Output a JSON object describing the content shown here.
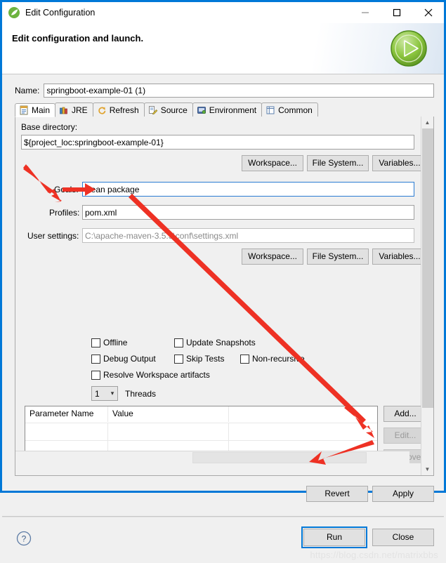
{
  "window": {
    "title": "Edit Configuration",
    "icon": "springboot-leaf-icon",
    "minimize_label": "—",
    "maximize_label": "☐",
    "close_label": "✕"
  },
  "banner": {
    "title": "Edit configuration and launch.",
    "icon": "run-play-icon"
  },
  "name_field": {
    "label": "Name:",
    "value": "springboot-example-01 (1)"
  },
  "tabs": [
    {
      "label": "Main",
      "icon": "main-form-icon",
      "active": true
    },
    {
      "label": "JRE",
      "icon": "jre-library-icon",
      "active": false
    },
    {
      "label": "Refresh",
      "icon": "refresh-icon",
      "active": false
    },
    {
      "label": "Source",
      "icon": "source-edit-icon",
      "active": false
    },
    {
      "label": "Environment",
      "icon": "environment-icon",
      "active": false
    },
    {
      "label": "Common",
      "icon": "common-icon",
      "active": false
    }
  ],
  "main_tab": {
    "base_directory": {
      "label": "Base directory:",
      "value": "${project_loc:springboot-example-01}"
    },
    "dir_buttons": [
      {
        "label": "Workspace..."
      },
      {
        "label": "File System..."
      },
      {
        "label": "Variables..."
      }
    ],
    "goals": {
      "label": "Goals:",
      "value": "clean package",
      "focused": true
    },
    "profiles": {
      "label": "Profiles:",
      "value": "pom.xml"
    },
    "user_settings": {
      "label": "User settings:",
      "value": "C:\\apache-maven-3.5.3\\conf\\settings.xml",
      "disabled": true
    },
    "settings_buttons": [
      {
        "label": "Workspace..."
      },
      {
        "label": "File System..."
      },
      {
        "label": "Variables..."
      }
    ],
    "checkboxes": [
      {
        "label": "Offline",
        "checked": false
      },
      {
        "label": "Update Snapshots",
        "checked": false
      },
      {
        "label": "Debug Output",
        "checked": false
      },
      {
        "label": "Skip Tests",
        "checked": false
      },
      {
        "label": "Non-recursive",
        "checked": false
      },
      {
        "label": "Resolve Workspace artifacts",
        "checked": false
      }
    ],
    "threads": {
      "value": "1",
      "label": "Threads",
      "arrow": "chevron-down-icon"
    },
    "parameter_table": {
      "columns": [
        "Parameter Name",
        "Value",
        ""
      ],
      "rows": [
        [
          "",
          "",
          ""
        ],
        [
          "",
          "",
          ""
        ],
        [
          "",
          "",
          ""
        ]
      ]
    },
    "table_buttons": [
      {
        "label": "Add...",
        "disabled": false
      },
      {
        "label": "Edit...",
        "disabled": true
      },
      {
        "label": "Remove",
        "disabled": true
      }
    ]
  },
  "dialog_buttons": {
    "revert": "Revert",
    "apply": "Apply",
    "run": "Run",
    "close": "Close",
    "help_icon": "help-question-icon"
  },
  "watermark": "https://blog.csdn.net/matrixbbs",
  "colors": {
    "window_border": "#0078d7",
    "accent": "#0078d7",
    "annotation_red": "#ee3124",
    "panel_bg": "#f0f0f0",
    "field_bg": "#ffffff",
    "focus_border": "#2b7cd3"
  }
}
